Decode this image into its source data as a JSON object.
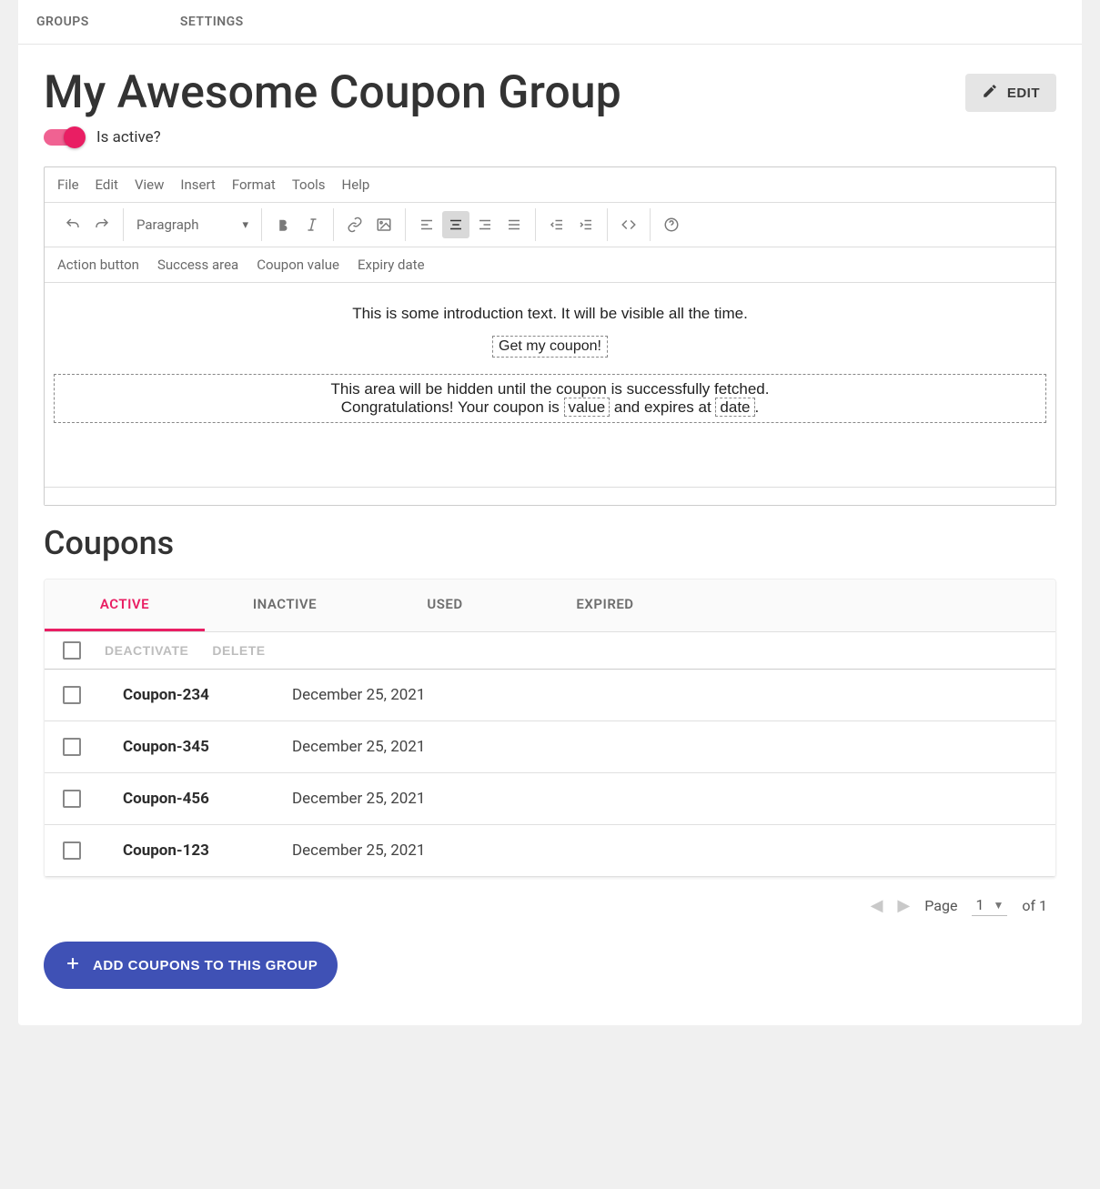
{
  "top_tabs": {
    "groups": "GROUPS",
    "settings": "SETTINGS"
  },
  "header": {
    "title": "My Awesome Coupon Group",
    "edit": "EDIT",
    "toggle_label": "Is active?"
  },
  "editor": {
    "menu": {
      "file": "File",
      "edit": "Edit",
      "view": "View",
      "insert": "Insert",
      "format": "Format",
      "tools": "Tools",
      "help": "Help"
    },
    "style_value": "Paragraph",
    "custom": {
      "action_button": "Action button",
      "success_area": "Success area",
      "coupon_value": "Coupon value",
      "expiry_date": "Expiry date"
    },
    "body": {
      "intro": "This is some introduction text. It will be visible all the time.",
      "action_chip": "Get my coupon!",
      "hidden_msg": "This area will be hidden until the coupon is successfully fetched.",
      "congrats_before": "Congratulations! Your coupon is ",
      "value_token": "value",
      "congrats_mid": " and expires at ",
      "date_token": "date",
      "congrats_after": "."
    }
  },
  "coupons": {
    "heading": "Coupons",
    "tabs": {
      "active": "ACTIVE",
      "inactive": "INACTIVE",
      "used": "USED",
      "expired": "EXPIRED"
    },
    "actions": {
      "deactivate": "DEACTIVATE",
      "delete": "DELETE"
    },
    "rows": [
      {
        "name": "Coupon-234",
        "date": "December 25, 2021"
      },
      {
        "name": "Coupon-345",
        "date": "December 25, 2021"
      },
      {
        "name": "Coupon-456",
        "date": "December 25, 2021"
      },
      {
        "name": "Coupon-123",
        "date": "December 25, 2021"
      }
    ],
    "pagination": {
      "page_label": "Page",
      "current": "1",
      "of": "of 1"
    },
    "add_button": "ADD COUPONS TO THIS GROUP"
  }
}
